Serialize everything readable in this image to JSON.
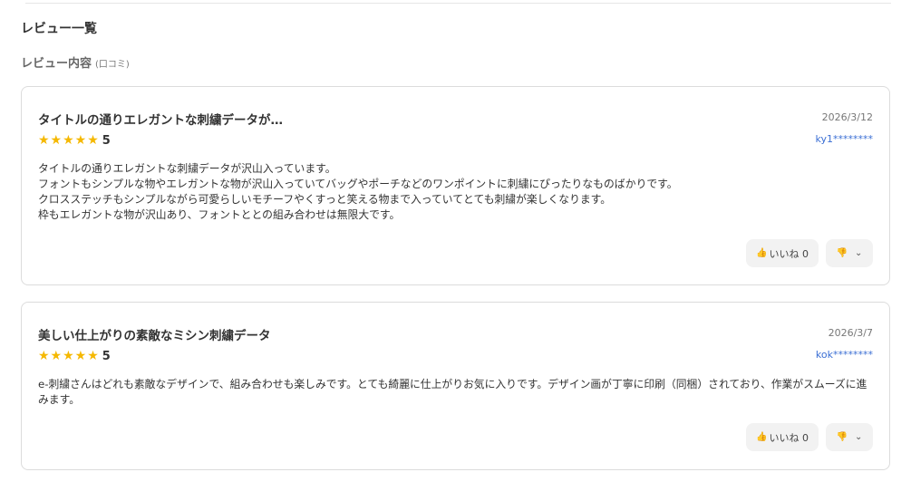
{
  "page": {
    "section_title": "レビュー一覧",
    "subtitle": "レビュー内容",
    "subtitle_note": "(口コミ)"
  },
  "reviews": [
    {
      "title": "タイトルの通りエレガントな刺繍データが…",
      "date": "2026/3/12",
      "stars": "★★★★★",
      "rating": "5",
      "user": "ky1********",
      "body": [
        "タイトルの通りエレガントな刺繍データが沢山入っています。",
        "フォントもシンプルな物やエレガントな物が沢山入っていてバッグやポーチなどのワンポイントに刺繍にぴったりなものばかりです。",
        "クロスステッチもシンプルながら可愛らしいモチーフやくすっと笑える物まで入っていてとても刺繍が楽しくなります。",
        "枠もエレガントな物が沢山あり、フォントととの組み合わせは無限大です。"
      ],
      "like_label": "いいね 0",
      "like_icon": "👍",
      "dislike_icon": "👎",
      "chevron": "⌄"
    },
    {
      "title": "美しい仕上がりの素敵なミシン刺繍データ",
      "date": "2026/3/7",
      "stars": "★★★★★",
      "rating": "5",
      "user": "kok********",
      "body": [
        "e-刺繍さんはどれも素敵なデザインで、組み合わせも楽しみです。とても綺麗に仕上がりお気に入りです。デザイン画が丁寧に印刷（同梱）されており、作業がスムーズに進みます。"
      ],
      "like_label": "いいね 0",
      "like_icon": "👍",
      "dislike_icon": "👎",
      "chevron": "⌄"
    }
  ]
}
